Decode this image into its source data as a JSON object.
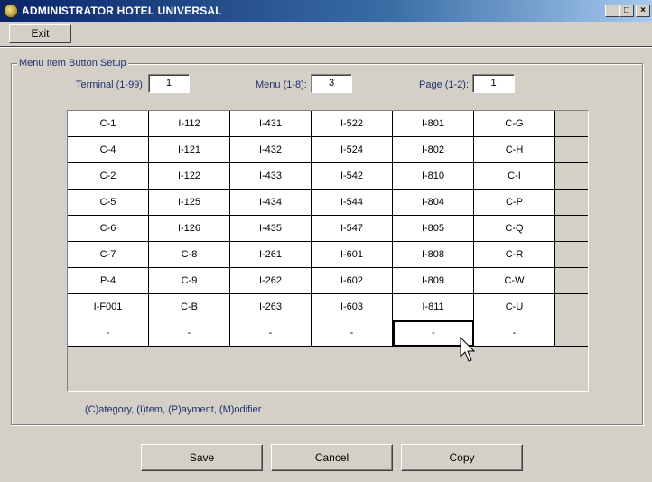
{
  "window": {
    "title": "ADMINISTRATOR HOTEL UNIVERSAL",
    "minimize_glyph": "_",
    "maximize_glyph": "□",
    "close_glyph": "×"
  },
  "toolbar": {
    "exit_label": "Exit"
  },
  "group": {
    "label": "Menu Item Button Setup"
  },
  "fields": {
    "terminal": {
      "label": "Terminal (1-99):",
      "value": "1"
    },
    "menu": {
      "label": "Menu (1-8):",
      "value": "3"
    },
    "page": {
      "label": "Page (1-2):",
      "value": "1"
    }
  },
  "grid": {
    "rows": [
      [
        "C-1",
        "I-112",
        "I-431",
        "I-522",
        "I-801",
        "C-G"
      ],
      [
        "C-4",
        "I-121",
        "I-432",
        "I-524",
        "I-802",
        "C-H"
      ],
      [
        "C-2",
        "I-122",
        "I-433",
        "I-542",
        "I-810",
        "C-I"
      ],
      [
        "C-5",
        "I-125",
        "I-434",
        "I-544",
        "I-804",
        "C-P"
      ],
      [
        "C-6",
        "I-126",
        "I-435",
        "I-547",
        "I-805",
        "C-Q"
      ],
      [
        "C-7",
        "C-8",
        "I-261",
        "I-601",
        "I-808",
        "C-R"
      ],
      [
        "P-4",
        "C-9",
        "I-262",
        "I-602",
        "I-809",
        "C-W"
      ],
      [
        "I-F001",
        "C-B",
        "I-263",
        "I-603",
        "I-811",
        "C-U"
      ],
      [
        "-",
        "-",
        "-",
        "-",
        "-",
        "-"
      ]
    ],
    "selected_row": 8,
    "selected_col": 4
  },
  "legend": "(C)ategory, (I)tem, (P)ayment, (M)odifier",
  "buttons": {
    "save": "Save",
    "cancel": "Cancel",
    "copy": "Copy"
  },
  "colors": {
    "title_bar": "#0a246a",
    "label_text": "#1c3270",
    "window_bg": "#d4d0c8"
  }
}
